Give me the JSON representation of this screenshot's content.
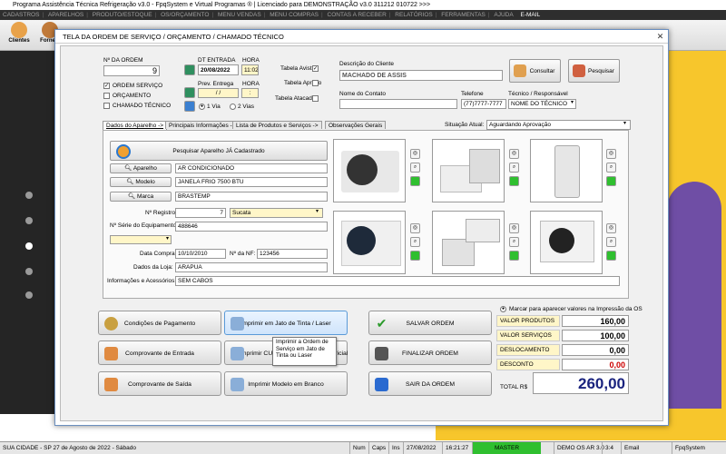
{
  "window": {
    "title": "Programa Assistência Técnica Refrigeração v3.0 - FpqSystem e Virtual Programas ® | Licenciado para  DEMONSTRAÇÃO v3.0 311212 010722 >>>"
  },
  "menu": {
    "items": [
      "CADASTROS",
      "APARELHOS",
      "PRODUTO/ESTOQUE",
      "OS/ORÇAMENTO",
      "MENU VENDAS",
      "MENU COMPRAS",
      "CONTAS A RECEBER",
      "RELATÓRIOS",
      "FERRAMENTAS",
      "AJUDA"
    ],
    "email": "E-MAIL"
  },
  "toolbar": {
    "items": [
      "Clientes",
      "Forneci"
    ]
  },
  "dialog": {
    "title": "TELA DA ORDEM DE SERVIÇO / ORÇAMENTO / CHAMADO TÉCNICO",
    "close": "✕",
    "order": {
      "label": "Nº DA ORDEM",
      "value": "9"
    },
    "types": [
      {
        "label": "ORDEM SERVIÇO",
        "checked": true
      },
      {
        "label": "ORÇAMENTO",
        "checked": false
      },
      {
        "label": "CHAMADO TÉCNICO",
        "checked": false
      }
    ],
    "dates": {
      "entry_label": "DT ENTRADA",
      "entry_value": "20/08/2022",
      "hour_label": "HORA",
      "hour_value": "11:02",
      "prev_label": "Prev. Entrega",
      "prev_value": "/ /",
      "prev_hour_label": "HORA",
      "prev_hour_value": ":",
      "via1": "1 Via",
      "via2": "2 Vias"
    },
    "tables": [
      {
        "label": "Tabela Avista",
        "checked": true
      },
      {
        "label": "Tabela Aprazo",
        "checked": false
      },
      {
        "label": "Tabela Atacado",
        "checked": false
      }
    ],
    "client": {
      "desc_label": "Descrição do Cliente",
      "desc_value": "MACHADO DE ASSIS",
      "contact_label": "Nome do Contato",
      "contact_value": "",
      "phone_label": "Telefone",
      "phone_value": "(77)7777-7777",
      "tech_label": "Técnico / Responsável",
      "tech_value": "NOME DO TÉCNICO",
      "consult": "Consultar",
      "search": "Pesquisar"
    },
    "tabs": [
      "Dados do Aparelho ->",
      "Principais Informações ->",
      "Lista de Produtos e Serviços ->",
      "Observações Gerais"
    ],
    "situation": {
      "label": "Situação Atual:",
      "value": "Aguardando Aprovação"
    },
    "device": {
      "search_btn": "Pesquisar Aparelho JÁ Cadastrado",
      "aparelho_btn": "Aparelho",
      "aparelho_value": "AR CONDICIONADO",
      "modelo_btn": "Modelo",
      "modelo_value": "JANELA FRIO 7500 BTU",
      "marca_btn": "Marca",
      "marca_value": "BRASTEMP",
      "registro_label": "Nº Registro:",
      "registro_value": "7",
      "registro_status": "Sucata",
      "serie_label": "Nº Série do Equipamento:",
      "serie_value": "488646",
      "compra_label": "Data Compra:",
      "compra_value": "10/10/2010",
      "nf_label": "Nº da NF:",
      "nf_value": "123456",
      "loja_label": "Dados da Loja:",
      "loja_value": "ARAPUA",
      "acess_label": "Informações e Acessórios:",
      "acess_value": "SEM CABOS"
    },
    "print_note": "Marcar para aparecer valores na Impressão da OS",
    "values": [
      {
        "label": "VALOR PRODUTOS",
        "value": "160,00",
        "color": "#000000"
      },
      {
        "label": "VALOR SERVIÇOS",
        "value": "100,00",
        "color": "#000000"
      },
      {
        "label": "DESLOCAMENTO",
        "value": "0,00",
        "color": "#000000"
      },
      {
        "label": "DESCONTO",
        "value": "0,00",
        "color": "#cc0000"
      }
    ],
    "total": {
      "label": "TOTAL R$",
      "value": "260,00"
    },
    "actions": {
      "cond": "Condições de Pagamento",
      "jato": "Imprimir em Jato de Tinta / Laser",
      "salvar": "SALVAR ORDEM",
      "entrada": "Comprovante de Entrada",
      "cupom": "Imprimir CU",
      "matricial": "Matricial",
      "finalizar": "FINALIZAR ORDEM",
      "saida": "Comprovante de Saída",
      "branco": "Imprimir Modelo em Branco",
      "sair": "SAIR DA ORDEM"
    },
    "tooltip": "Imprimir a Ordem de Serviço em Jato de Tinta ou Laser"
  },
  "status": {
    "city": "SUA CIDADE - SP 27 de Agosto de 2022 - Sábado",
    "num": "Num",
    "caps": "Caps",
    "ins": "Ins",
    "date": "27/08/2022",
    "time": "16:21:27",
    "master": "MASTER",
    "os": "DEMO OS AR 3.0",
    "n": "3:4",
    "email": "Email",
    "brand": "FpqSystem"
  },
  "colors": {
    "accent": "#1f6fd0",
    "yellow": "#f7c62c",
    "menu": "#2e2e2e",
    "total": "#1a237e",
    "green": "#2fbf2f"
  }
}
